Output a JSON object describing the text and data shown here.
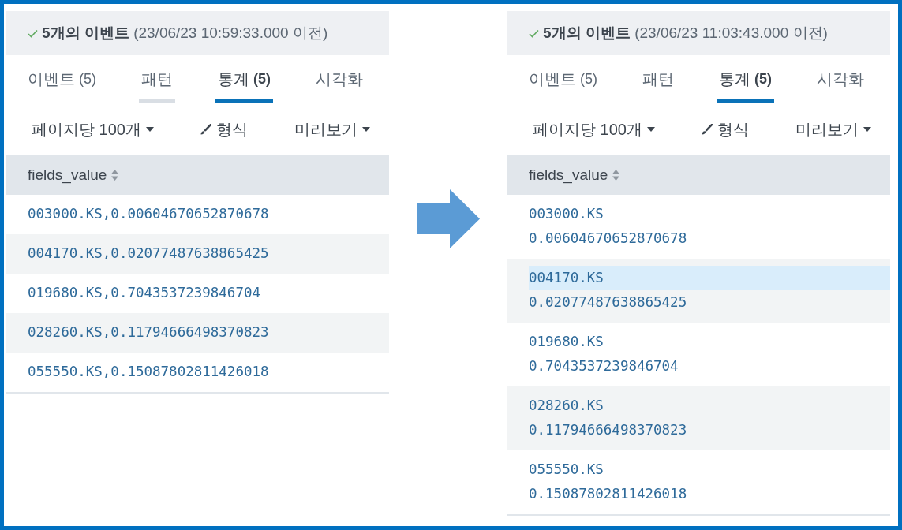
{
  "panels": [
    {
      "summary": "**5개의 이벤트** (23/06/23 10:59:33.000 이전)",
      "tabs": [
        {
          "label": "이벤트",
          "count": "(5)",
          "selected": false,
          "hovered": false
        },
        {
          "label": "패턴",
          "selected": false,
          "hovered": true
        },
        {
          "label": "통계",
          "count": "(5)",
          "selected": true,
          "hovered": false
        },
        {
          "label": "시각화",
          "selected": false,
          "hovered": false
        }
      ],
      "toolbar": [
        {
          "label": "페이지당 100개",
          "kind": "dropdown"
        },
        {
          "label": "형식",
          "kind": "edit"
        },
        {
          "label": "미리보기",
          "kind": "dropdown"
        }
      ],
      "table": {
        "columns": [
          "fields_value"
        ],
        "rows": [
          {
            "lines": [
              {
                "text": "003000.KS,0.00604670652870678",
                "highlighted": false
              }
            ]
          },
          {
            "lines": [
              {
                "text": "004170.KS,0.02077487638865425",
                "highlighted": false
              }
            ]
          },
          {
            "lines": [
              {
                "text": "019680.KS,0.7043537239846704",
                "highlighted": false
              }
            ]
          },
          {
            "lines": [
              {
                "text": "028260.KS,0.11794666498370823",
                "highlighted": false
              }
            ]
          },
          {
            "lines": [
              {
                "text": "055550.KS,0.15087802811426018",
                "highlighted": false
              }
            ]
          }
        ]
      }
    },
    {
      "summary": "**5개의 이벤트** (23/06/23 11:03:43.000 이전)",
      "tabs": [
        {
          "label": "이벤트",
          "count": "(5)",
          "selected": false,
          "hovered": false
        },
        {
          "label": "패턴",
          "selected": false,
          "hovered": false
        },
        {
          "label": "통계",
          "count": "(5)",
          "selected": true,
          "hovered": false
        },
        {
          "label": "시각화",
          "selected": false,
          "hovered": false
        }
      ],
      "toolbar": [
        {
          "label": "페이지당 100개",
          "kind": "dropdown"
        },
        {
          "label": "형식",
          "kind": "edit"
        },
        {
          "label": "미리보기",
          "kind": "dropdown"
        }
      ],
      "table": {
        "columns": [
          "fields_value"
        ],
        "rows": [
          {
            "lines": [
              {
                "text": "003000.KS",
                "highlighted": false
              },
              {
                "text": "0.00604670652870678",
                "highlighted": false
              }
            ]
          },
          {
            "lines": [
              {
                "text": "004170.KS",
                "highlighted": true
              },
              {
                "text": "0.02077487638865425",
                "highlighted": false
              }
            ]
          },
          {
            "lines": [
              {
                "text": "019680.KS",
                "highlighted": false
              },
              {
                "text": "0.7043537239846704",
                "highlighted": false
              }
            ]
          },
          {
            "lines": [
              {
                "text": "028260.KS",
                "highlighted": false
              },
              {
                "text": "0.11794666498370823",
                "highlighted": false
              }
            ]
          },
          {
            "lines": [
              {
                "text": "055550.KS",
                "highlighted": false
              },
              {
                "text": "0.15087802811426018",
                "highlighted": false
              }
            ]
          }
        ]
      }
    }
  ]
}
